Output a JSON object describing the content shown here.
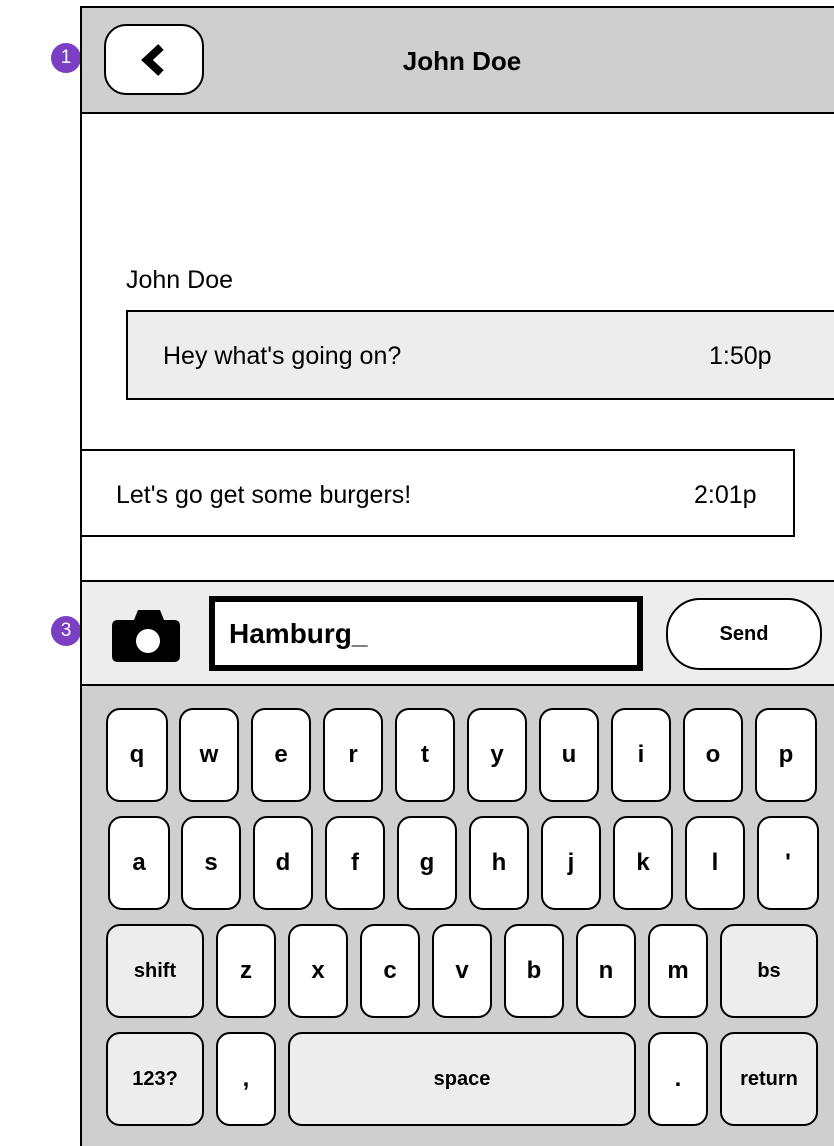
{
  "callouts": [
    "1",
    "3"
  ],
  "header": {
    "title": "John Doe",
    "back_icon": "chevron-left-icon"
  },
  "messages": {
    "incoming": {
      "sender": "John Doe",
      "text": "Hey what's going on?",
      "time": "1:50p"
    },
    "outgoing": {
      "text": "Let's go get some burgers!",
      "time": "2:01p"
    }
  },
  "compose": {
    "camera_icon": "camera-icon",
    "input_value": "Hamburg_",
    "send_label": "Send"
  },
  "keyboard": {
    "row1": [
      "q",
      "w",
      "e",
      "r",
      "t",
      "y",
      "u",
      "i",
      "o",
      "p"
    ],
    "row2": [
      "a",
      "s",
      "d",
      "f",
      "g",
      "h",
      "j",
      "k",
      "l",
      "'"
    ],
    "row3": [
      "shift",
      "z",
      "x",
      "c",
      "v",
      "b",
      "n",
      "m",
      "bs"
    ],
    "row4": [
      "123?",
      ",",
      "space",
      ".",
      "return"
    ]
  },
  "colors": {
    "bar_gray": "#d0cfd0",
    "light_gray": "#eeedee",
    "callout": "#7b3fc4"
  }
}
